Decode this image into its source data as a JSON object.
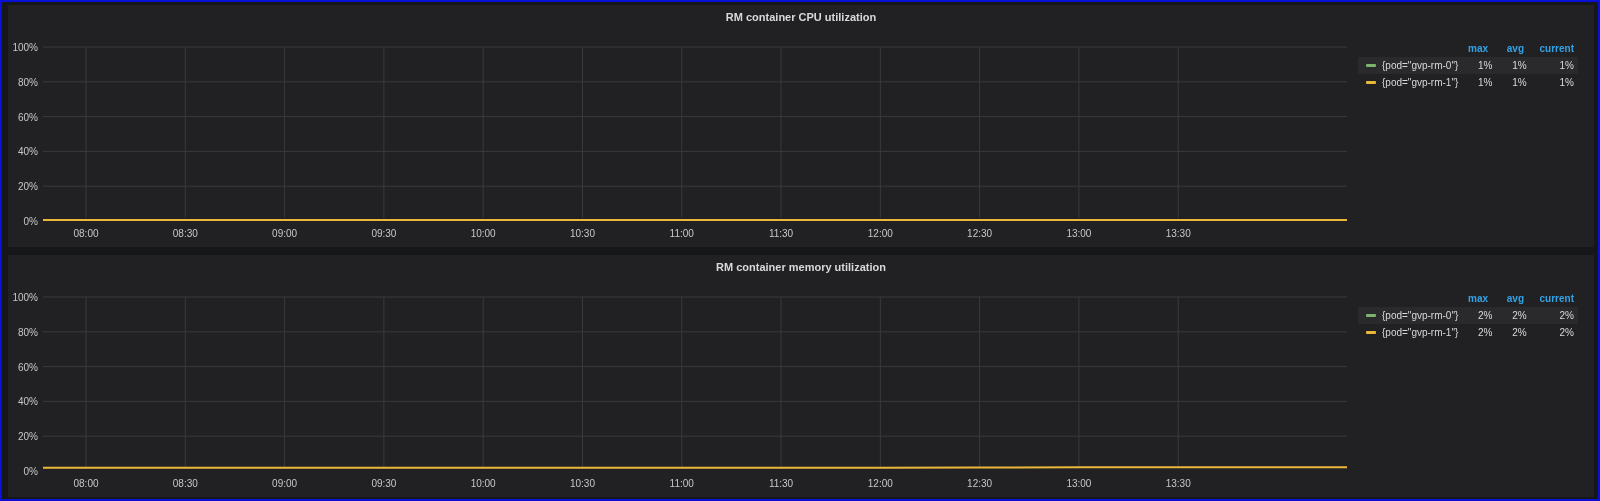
{
  "panels": [
    {
      "title": "RM container CPU utilization",
      "chart_data": {
        "type": "line",
        "grid": true,
        "x": [
          467,
          480,
          510,
          540,
          570,
          600,
          630,
          660,
          690,
          720,
          750,
          780,
          810,
          840,
          861
        ],
        "xlim": [
          467,
          861
        ],
        "ylim": [
          0,
          100
        ],
        "xticks": [
          {
            "value": 480,
            "label": "08:00"
          },
          {
            "value": 510,
            "label": "08:30"
          },
          {
            "value": 540,
            "label": "09:00"
          },
          {
            "value": 570,
            "label": "09:30"
          },
          {
            "value": 600,
            "label": "10:00"
          },
          {
            "value": 630,
            "label": "10:30"
          },
          {
            "value": 660,
            "label": "11:00"
          },
          {
            "value": 690,
            "label": "11:30"
          },
          {
            "value": 720,
            "label": "12:00"
          },
          {
            "value": 750,
            "label": "12:30"
          },
          {
            "value": 780,
            "label": "13:00"
          },
          {
            "value": 810,
            "label": "13:30"
          }
        ],
        "yticks": [
          {
            "value": 0,
            "label": "0%"
          },
          {
            "value": 20,
            "label": "20%"
          },
          {
            "value": 40,
            "label": "40%"
          },
          {
            "value": 60,
            "label": "60%"
          },
          {
            "value": 80,
            "label": "80%"
          },
          {
            "value": 100,
            "label": "100%"
          }
        ],
        "series": [
          {
            "name": "{pod=\"gvp-rm-0\"}",
            "color": "#7eb26d",
            "values": [
              null,
              null,
              null,
              null,
              null,
              null,
              null,
              null,
              null,
              null,
              null,
              null,
              null,
              null,
              null
            ]
          },
          {
            "name": "{pod=\"gvp-rm-1\"}",
            "color": "#eab839",
            "values": [
              0.6,
              0.6,
              0.6,
              0.6,
              0.6,
              0.6,
              0.6,
              0.6,
              0.6,
              0.6,
              0.6,
              0.6,
              0.6,
              0.6,
              0.6
            ]
          }
        ]
      },
      "legend": {
        "columns": [
          "max",
          "avg",
          "current"
        ],
        "rows": [
          {
            "values": [
              "1%",
              "1%",
              "1%"
            ]
          },
          {
            "values": [
              "1%",
              "1%",
              "1%"
            ]
          }
        ]
      }
    },
    {
      "title": "RM container memory utilization",
      "chart_data": {
        "type": "line",
        "grid": true,
        "x": [
          467,
          480,
          510,
          540,
          570,
          600,
          630,
          660,
          690,
          720,
          750,
          780,
          810,
          840,
          861
        ],
        "xlim": [
          467,
          861
        ],
        "ylim": [
          0,
          100
        ],
        "xticks": [
          {
            "value": 480,
            "label": "08:00"
          },
          {
            "value": 510,
            "label": "08:30"
          },
          {
            "value": 540,
            "label": "09:00"
          },
          {
            "value": 570,
            "label": "09:30"
          },
          {
            "value": 600,
            "label": "10:00"
          },
          {
            "value": 630,
            "label": "10:30"
          },
          {
            "value": 660,
            "label": "11:00"
          },
          {
            "value": 690,
            "label": "11:30"
          },
          {
            "value": 720,
            "label": "12:00"
          },
          {
            "value": 750,
            "label": "12:30"
          },
          {
            "value": 780,
            "label": "13:00"
          },
          {
            "value": 810,
            "label": "13:30"
          }
        ],
        "yticks": [
          {
            "value": 0,
            "label": "0%"
          },
          {
            "value": 20,
            "label": "20%"
          },
          {
            "value": 40,
            "label": "40%"
          },
          {
            "value": 60,
            "label": "60%"
          },
          {
            "value": 80,
            "label": "80%"
          },
          {
            "value": 100,
            "label": "100%"
          }
        ],
        "series": [
          {
            "name": "{pod=\"gvp-rm-0\"}",
            "color": "#7eb26d",
            "values": [
              null,
              null,
              null,
              null,
              null,
              null,
              null,
              null,
              null,
              null,
              null,
              null,
              null,
              null,
              null
            ]
          },
          {
            "name": "{pod=\"gvp-rm-1\"}",
            "color": "#eab839",
            "values": [
              1.9,
              1.9,
              1.9,
              1.9,
              1.9,
              1.9,
              1.9,
              1.9,
              1.9,
              1.9,
              2,
              2.1,
              2.1,
              2.1,
              2.1
            ]
          }
        ]
      },
      "legend": {
        "columns": [
          "max",
          "avg",
          "current"
        ],
        "rows": [
          {
            "values": [
              "2%",
              "2%",
              "2%"
            ]
          },
          {
            "values": [
              "2%",
              "2%",
              "2%"
            ]
          }
        ]
      }
    }
  ]
}
